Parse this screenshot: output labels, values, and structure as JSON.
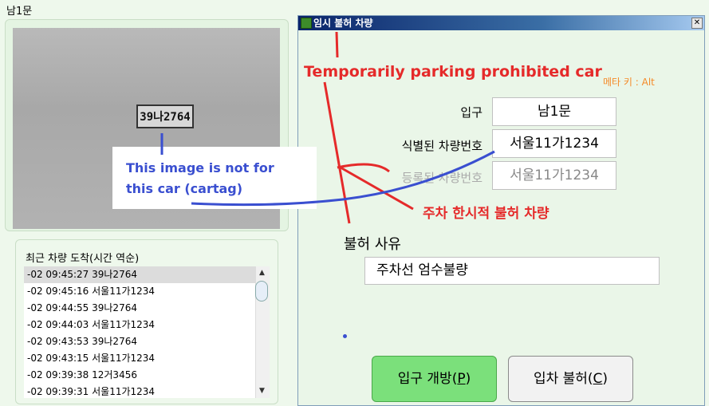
{
  "window": {
    "title": "남1문"
  },
  "camera": {
    "plate_text": "39나2764"
  },
  "recent": {
    "title": "최근 차량 도착(시간 역순)",
    "items": [
      "-02 09:45:27 39나2764",
      "-02 09:45:16 서울11가1234",
      "-02 09:44:55 39나2764",
      "-02 09:44:03 서울11가1234",
      "-02 09:43:53 39나2764",
      "-02 09:43:15 서울11가1234",
      "-02 09:39:38 12거3456",
      "-02 09:39:31 서울11가1234"
    ],
    "scroll_up": "▲",
    "scroll_down": "▼"
  },
  "dialog": {
    "title": "임시 불허 차량",
    "close": "✕",
    "meta_key": "메타 키 : Alt",
    "entrance_label": "입구",
    "entrance_value": "남1문",
    "identified_plate_label": "식별된 차량번호",
    "identified_plate_value": "서울11가1234",
    "registered_plate_label": "등록된 차량번호",
    "registered_plate_value": "서울11가1234",
    "reason_label": "불허 사유",
    "reason_value": "주차선 엄수불량",
    "open_button": {
      "text": "입구 개방(",
      "key": "P",
      "end": ")"
    },
    "deny_button": {
      "text": "입차 불허(",
      "key": "C",
      "end": ")"
    }
  },
  "annotations": {
    "english_title": "Temporarily parking prohibited car",
    "korean_label": "주차 한시적 불허 차량",
    "note_line1": "This image is not for",
    "note_line2": "this car (cartag)"
  },
  "colors": {
    "background": "#eef8ec",
    "open_button": "#7be07b",
    "annotation_red": "#e52a2a",
    "annotation_blue": "#3a4fd0",
    "meta_key": "#f58a28"
  }
}
